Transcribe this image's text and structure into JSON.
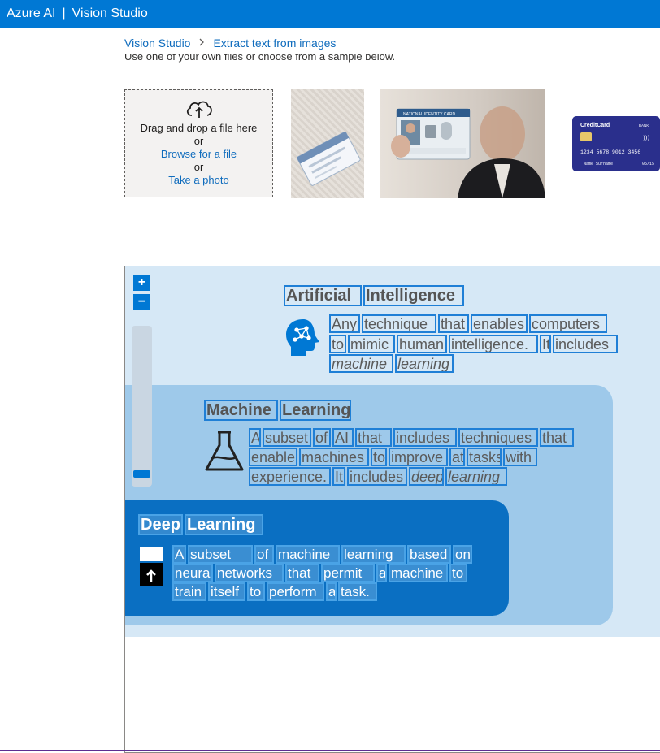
{
  "header": {
    "brand": "Azure AI",
    "separator": "|",
    "product": "Vision Studio"
  },
  "breadcrumb": {
    "items": [
      "Vision Studio",
      "Extract text from images"
    ]
  },
  "hint_text": "Use one of your own files or choose from a sample below.",
  "dropzone": {
    "drag_text": "Drag and drop a file here",
    "or1": "or",
    "browse": "Browse for a file",
    "or2": "or",
    "photo": "Take a photo"
  },
  "samples": {
    "card_brand": "CreditCard",
    "card_bank": "BANK",
    "card_number": "1234 5678 9012 3456",
    "card_name": "Name Surname",
    "card_exp": "05/15",
    "id_header": "NATIONAL IDENTITY CARD"
  },
  "zoom": {
    "in": "+",
    "out": "−"
  },
  "image_text": {
    "ai": {
      "title": [
        "Artificial",
        "Intelligence"
      ],
      "line1": [
        "Any",
        "technique",
        "that",
        "enables",
        "computers"
      ],
      "line2": [
        "to",
        "mimic",
        "human",
        "intelligence.",
        "It",
        "includes"
      ],
      "line3": [
        "machine",
        "learning"
      ]
    },
    "ml": {
      "title": [
        "Machine",
        "Learning"
      ],
      "line1": [
        "A",
        "subset",
        "of",
        "AI",
        "that",
        "includes",
        "techniques",
        "that"
      ],
      "line2": [
        "enable",
        "machines",
        "to",
        "improve",
        "at",
        "tasks",
        "with"
      ],
      "line3": [
        "experience.",
        "It",
        "includes",
        "deep",
        "learning"
      ]
    },
    "dl": {
      "title": [
        "Deep",
        "Learning"
      ],
      "line1": [
        "A",
        "subset",
        "of",
        "machine",
        "learning",
        "based",
        "on"
      ],
      "line2": [
        "neural",
        "networks",
        "that",
        "permit",
        "a",
        "machine",
        "to"
      ],
      "line3": [
        "train",
        "itself",
        "to",
        "perform",
        "a",
        "task."
      ]
    }
  }
}
